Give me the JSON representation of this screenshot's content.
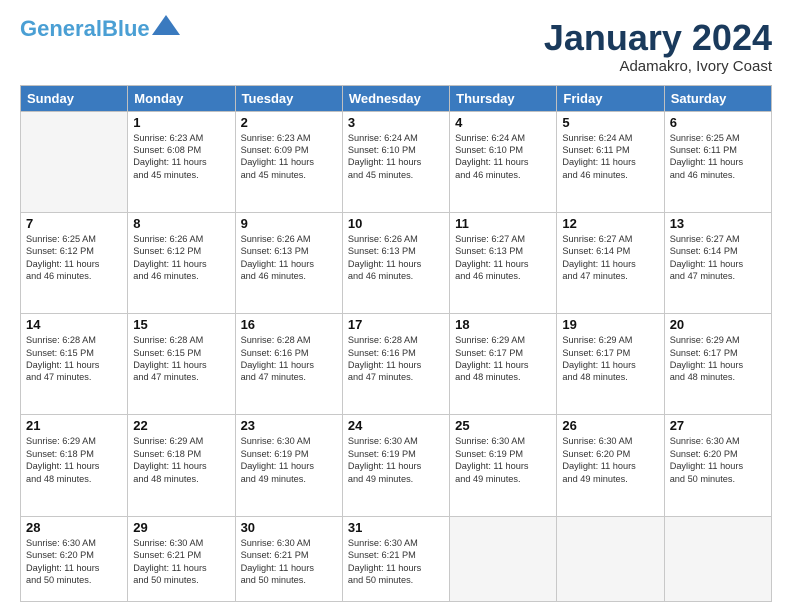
{
  "header": {
    "logo_general": "General",
    "logo_blue": "Blue",
    "month": "January 2024",
    "location": "Adamakro, Ivory Coast"
  },
  "days": [
    "Sunday",
    "Monday",
    "Tuesday",
    "Wednesday",
    "Thursday",
    "Friday",
    "Saturday"
  ],
  "weeks": [
    [
      {
        "day": "",
        "text": ""
      },
      {
        "day": "1",
        "text": "Sunrise: 6:23 AM\nSunset: 6:08 PM\nDaylight: 11 hours\nand 45 minutes."
      },
      {
        "day": "2",
        "text": "Sunrise: 6:23 AM\nSunset: 6:09 PM\nDaylight: 11 hours\nand 45 minutes."
      },
      {
        "day": "3",
        "text": "Sunrise: 6:24 AM\nSunset: 6:10 PM\nDaylight: 11 hours\nand 45 minutes."
      },
      {
        "day": "4",
        "text": "Sunrise: 6:24 AM\nSunset: 6:10 PM\nDaylight: 11 hours\nand 46 minutes."
      },
      {
        "day": "5",
        "text": "Sunrise: 6:24 AM\nSunset: 6:11 PM\nDaylight: 11 hours\nand 46 minutes."
      },
      {
        "day": "6",
        "text": "Sunrise: 6:25 AM\nSunset: 6:11 PM\nDaylight: 11 hours\nand 46 minutes."
      }
    ],
    [
      {
        "day": "7",
        "text": "Sunrise: 6:25 AM\nSunset: 6:12 PM\nDaylight: 11 hours\nand 46 minutes."
      },
      {
        "day": "8",
        "text": "Sunrise: 6:26 AM\nSunset: 6:12 PM\nDaylight: 11 hours\nand 46 minutes."
      },
      {
        "day": "9",
        "text": "Sunrise: 6:26 AM\nSunset: 6:13 PM\nDaylight: 11 hours\nand 46 minutes."
      },
      {
        "day": "10",
        "text": "Sunrise: 6:26 AM\nSunset: 6:13 PM\nDaylight: 11 hours\nand 46 minutes."
      },
      {
        "day": "11",
        "text": "Sunrise: 6:27 AM\nSunset: 6:13 PM\nDaylight: 11 hours\nand 46 minutes."
      },
      {
        "day": "12",
        "text": "Sunrise: 6:27 AM\nSunset: 6:14 PM\nDaylight: 11 hours\nand 47 minutes."
      },
      {
        "day": "13",
        "text": "Sunrise: 6:27 AM\nSunset: 6:14 PM\nDaylight: 11 hours\nand 47 minutes."
      }
    ],
    [
      {
        "day": "14",
        "text": "Sunrise: 6:28 AM\nSunset: 6:15 PM\nDaylight: 11 hours\nand 47 minutes."
      },
      {
        "day": "15",
        "text": "Sunrise: 6:28 AM\nSunset: 6:15 PM\nDaylight: 11 hours\nand 47 minutes."
      },
      {
        "day": "16",
        "text": "Sunrise: 6:28 AM\nSunset: 6:16 PM\nDaylight: 11 hours\nand 47 minutes."
      },
      {
        "day": "17",
        "text": "Sunrise: 6:28 AM\nSunset: 6:16 PM\nDaylight: 11 hours\nand 47 minutes."
      },
      {
        "day": "18",
        "text": "Sunrise: 6:29 AM\nSunset: 6:17 PM\nDaylight: 11 hours\nand 48 minutes."
      },
      {
        "day": "19",
        "text": "Sunrise: 6:29 AM\nSunset: 6:17 PM\nDaylight: 11 hours\nand 48 minutes."
      },
      {
        "day": "20",
        "text": "Sunrise: 6:29 AM\nSunset: 6:17 PM\nDaylight: 11 hours\nand 48 minutes."
      }
    ],
    [
      {
        "day": "21",
        "text": "Sunrise: 6:29 AM\nSunset: 6:18 PM\nDaylight: 11 hours\nand 48 minutes."
      },
      {
        "day": "22",
        "text": "Sunrise: 6:29 AM\nSunset: 6:18 PM\nDaylight: 11 hours\nand 48 minutes."
      },
      {
        "day": "23",
        "text": "Sunrise: 6:30 AM\nSunset: 6:19 PM\nDaylight: 11 hours\nand 49 minutes."
      },
      {
        "day": "24",
        "text": "Sunrise: 6:30 AM\nSunset: 6:19 PM\nDaylight: 11 hours\nand 49 minutes."
      },
      {
        "day": "25",
        "text": "Sunrise: 6:30 AM\nSunset: 6:19 PM\nDaylight: 11 hours\nand 49 minutes."
      },
      {
        "day": "26",
        "text": "Sunrise: 6:30 AM\nSunset: 6:20 PM\nDaylight: 11 hours\nand 49 minutes."
      },
      {
        "day": "27",
        "text": "Sunrise: 6:30 AM\nSunset: 6:20 PM\nDaylight: 11 hours\nand 50 minutes."
      }
    ],
    [
      {
        "day": "28",
        "text": "Sunrise: 6:30 AM\nSunset: 6:20 PM\nDaylight: 11 hours\nand 50 minutes."
      },
      {
        "day": "29",
        "text": "Sunrise: 6:30 AM\nSunset: 6:21 PM\nDaylight: 11 hours\nand 50 minutes."
      },
      {
        "day": "30",
        "text": "Sunrise: 6:30 AM\nSunset: 6:21 PM\nDaylight: 11 hours\nand 50 minutes."
      },
      {
        "day": "31",
        "text": "Sunrise: 6:30 AM\nSunset: 6:21 PM\nDaylight: 11 hours\nand 50 minutes."
      },
      {
        "day": "",
        "text": ""
      },
      {
        "day": "",
        "text": ""
      },
      {
        "day": "",
        "text": ""
      }
    ]
  ]
}
